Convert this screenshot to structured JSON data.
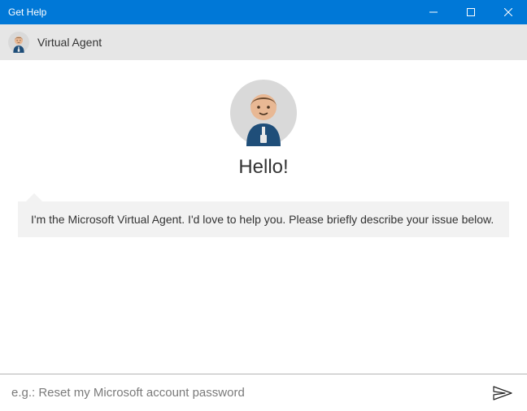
{
  "window": {
    "title": "Get Help"
  },
  "header": {
    "subtitle": "Virtual Agent"
  },
  "chat": {
    "greeting": "Hello!",
    "message": "I'm the Microsoft Virtual Agent. I'd love to help you. Please briefly describe your issue below."
  },
  "input": {
    "value": "",
    "placeholder": "e.g.: Reset my Microsoft account password"
  },
  "icons": {
    "avatar": "virtual-agent-avatar",
    "send": "send-icon"
  },
  "colors": {
    "accent": "#0078d7",
    "bubble": "#f2f2f2",
    "subbar": "#e6e6e6"
  }
}
